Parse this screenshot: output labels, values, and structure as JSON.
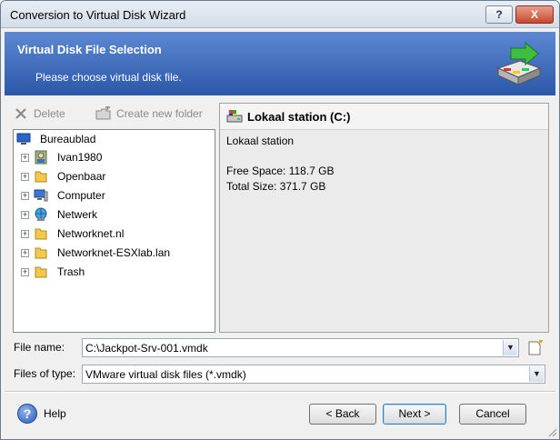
{
  "window": {
    "title": "Conversion to Virtual Disk Wizard",
    "help_button": "?",
    "close_button": "X"
  },
  "header": {
    "title": "Virtual Disk File Selection",
    "subtitle": "Please choose virtual disk file."
  },
  "toolbar": {
    "delete_label": "Delete",
    "new_folder_label": "Create new folder"
  },
  "tree": {
    "root": {
      "label": "Bureaublad",
      "icon": "desktop-icon"
    },
    "items": [
      {
        "label": "Ivan1980",
        "icon": "user-folder-icon"
      },
      {
        "label": "Openbaar",
        "icon": "folder-icon"
      },
      {
        "label": "Computer",
        "icon": "computer-icon"
      },
      {
        "label": "Netwerk",
        "icon": "network-icon"
      },
      {
        "label": "Networknet.nl",
        "icon": "folder-icon"
      },
      {
        "label": "Networknet-ESXlab.lan",
        "icon": "folder-icon"
      },
      {
        "label": "Trash",
        "icon": "folder-icon"
      }
    ],
    "expander_symbol": "+"
  },
  "detail": {
    "title": "Lokaal station (C:)",
    "description": "Lokaal station",
    "free_space": "Free Space: 118.7 GB",
    "total_size": "Total Size: 371.7 GB"
  },
  "form": {
    "file_name_label": "File name:",
    "file_name_value": "C:\\Jackpot-Srv-001.vmdk",
    "file_type_label": "Files of type:",
    "file_type_value": "VMware virtual disk files (*.vmdk)",
    "dropdown_symbol": "▼"
  },
  "footer": {
    "help_symbol": "?",
    "help_label": "Help",
    "back_label": "< Back",
    "next_label": "Next >",
    "cancel_label": "Cancel"
  },
  "colors": {
    "header_top": "#5d88d2",
    "header_bottom": "#2b57a8",
    "close_button": "#c9482e",
    "folder": "#f2c94c"
  }
}
